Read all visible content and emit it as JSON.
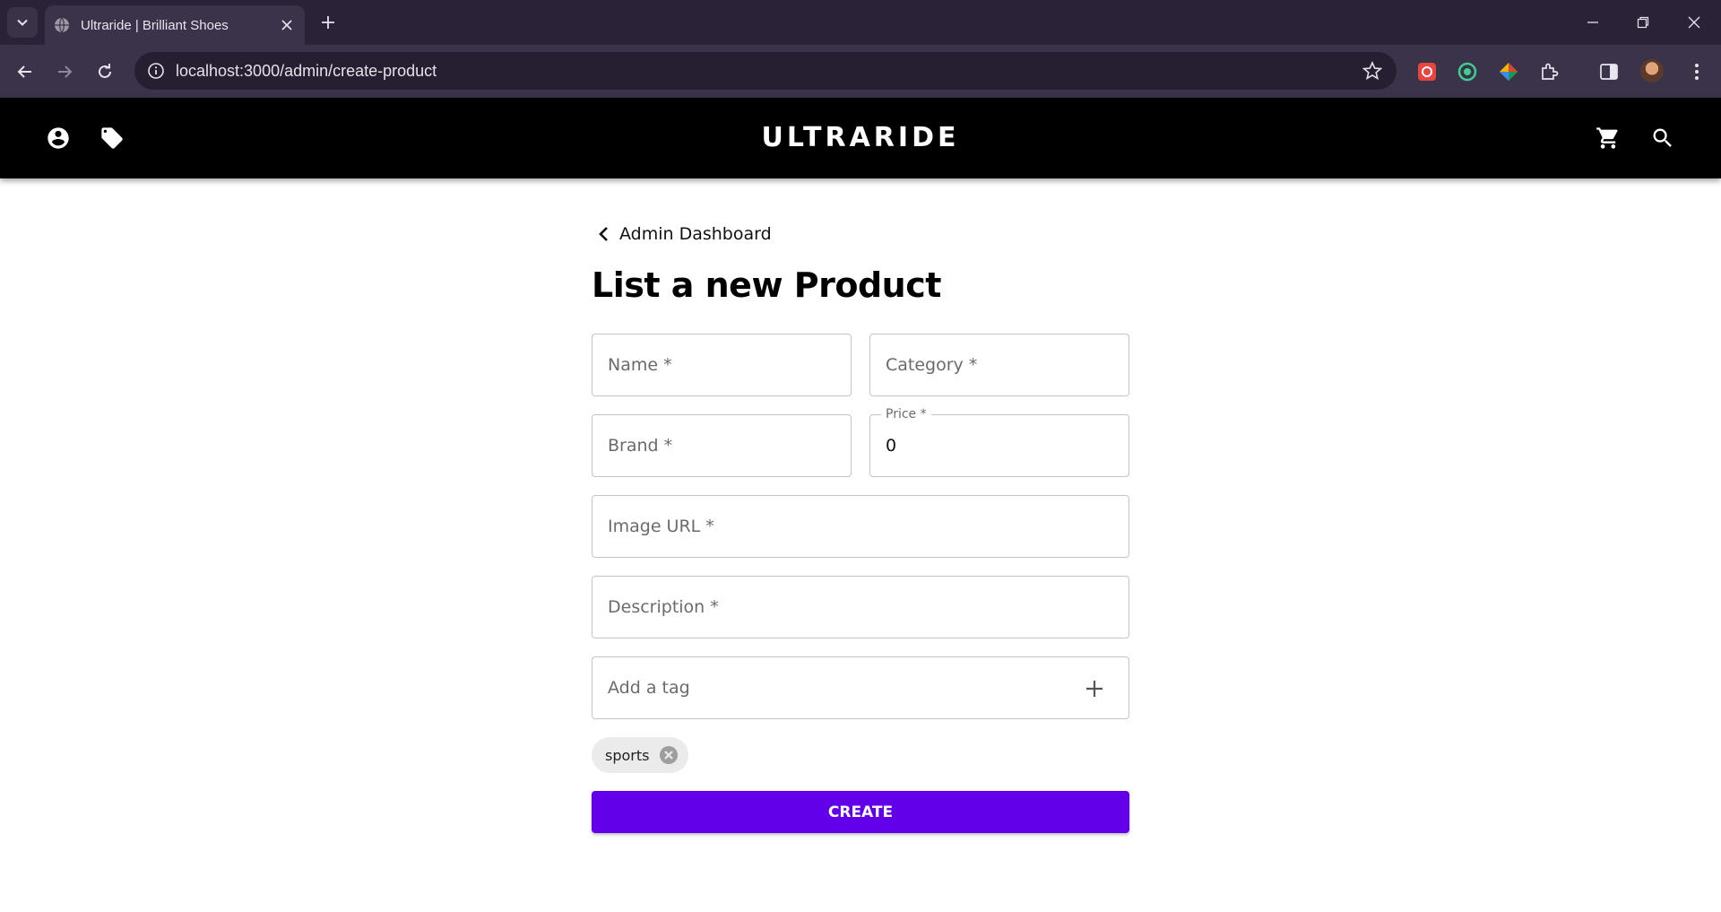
{
  "browser": {
    "tab_title": "Ultraride | Brilliant Shoes",
    "url": "localhost:3000/admin/create-product"
  },
  "header": {
    "brand": "ULTRARIDE",
    "background": "#000000"
  },
  "page": {
    "back_label": "Admin Dashboard",
    "title": "List a new Product"
  },
  "form": {
    "name_label": "Name *",
    "category_label": "Category *",
    "brand_label": "Brand *",
    "price_label": "Price *",
    "price_value": "0",
    "image_url_label": "Image URL *",
    "description_label": "Description *",
    "tag_placeholder": "Add a tag",
    "tags": [
      "sports"
    ],
    "submit_label": "CREATE"
  },
  "colors": {
    "accent": "#6200ea",
    "chrome_dark": "#2a2236",
    "chrome_toolbar": "#3b3349"
  },
  "icons": {
    "account": "account-circle-icon",
    "tag": "tag-icon",
    "cart": "cart-icon",
    "search": "search-icon",
    "back": "chevron-left-icon",
    "add_tag": "plus-icon",
    "remove_tag": "cancel-circle-icon"
  }
}
